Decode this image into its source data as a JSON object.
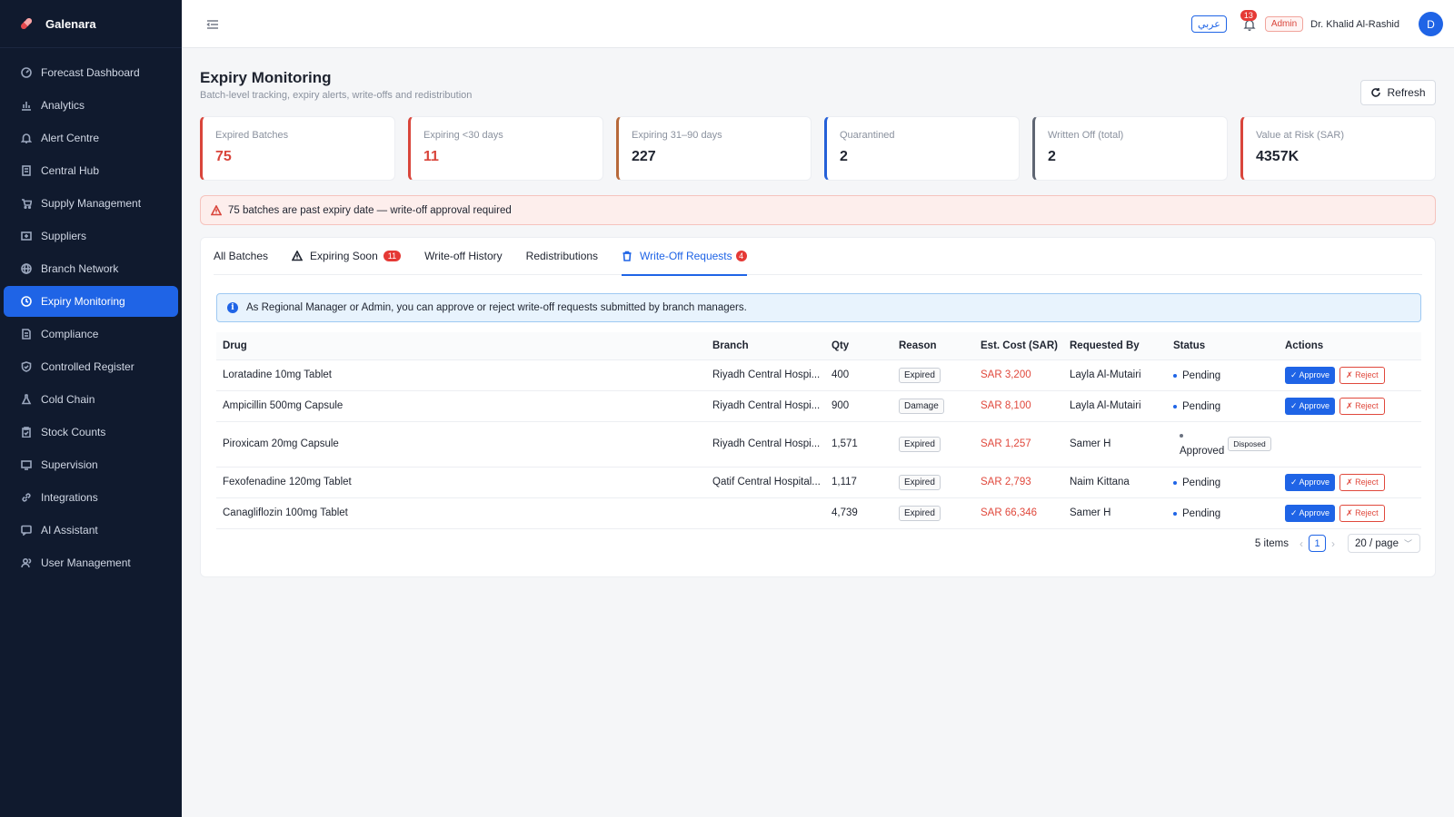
{
  "brand": {
    "name": "Galenara",
    "accent": "#1f64e6"
  },
  "sidebar": {
    "items": [
      {
        "label": "Forecast Dashboard",
        "icon": "dashboard-icon",
        "active": false
      },
      {
        "label": "Analytics",
        "icon": "bar-chart-icon",
        "active": false
      },
      {
        "label": "Alert Centre",
        "icon": "bell-icon",
        "active": false
      },
      {
        "label": "Central Hub",
        "icon": "building-icon",
        "active": false
      },
      {
        "label": "Supply Management",
        "icon": "cart-icon",
        "active": false
      },
      {
        "label": "Suppliers",
        "icon": "supplier-icon",
        "active": false
      },
      {
        "label": "Branch Network",
        "icon": "globe-icon",
        "active": false
      },
      {
        "label": "Expiry Monitoring",
        "icon": "clock-icon",
        "active": true
      },
      {
        "label": "Compliance",
        "icon": "document-icon",
        "active": false
      },
      {
        "label": "Controlled Register",
        "icon": "shield-icon",
        "active": false
      },
      {
        "label": "Cold Chain",
        "icon": "flask-icon",
        "active": false
      },
      {
        "label": "Stock Counts",
        "icon": "clipboard-icon",
        "active": false
      },
      {
        "label": "Supervision",
        "icon": "monitor-icon",
        "active": false
      },
      {
        "label": "Integrations",
        "icon": "link-icon",
        "active": false
      },
      {
        "label": "AI Assistant",
        "icon": "chat-icon",
        "active": false
      },
      {
        "label": "User Management",
        "icon": "users-icon",
        "active": false
      }
    ]
  },
  "topbar": {
    "lang_label": "عربي",
    "notif_count": "13",
    "role": "Admin",
    "user_name": "Dr. Khalid Al-Rashid",
    "avatar_initial": "D"
  },
  "page": {
    "title": "Expiry Monitoring",
    "subtitle": "Batch-level tracking, expiry alerts, write-offs and redistribution",
    "refresh_label": "Refresh"
  },
  "kpis": [
    {
      "label": "Expired Batches",
      "value": "75",
      "variant": "red"
    },
    {
      "label": "Expiring <30 days",
      "value": "11",
      "variant": "red"
    },
    {
      "label": "Expiring 31–90 days",
      "value": "227",
      "variant": "orange"
    },
    {
      "label": "Quarantined",
      "value": "2",
      "variant": "blue"
    },
    {
      "label": "Written Off (total)",
      "value": "2",
      "variant": "gray"
    },
    {
      "label": "Value at Risk (SAR)",
      "value": "4357K",
      "variant": "red-plain"
    }
  ],
  "alert": {
    "text": "75 batches are past expiry date — write-off approval required"
  },
  "tabs": [
    {
      "label": "All Batches"
    },
    {
      "label": "Expiring Soon",
      "badge": "11"
    },
    {
      "label": "Write-off History"
    },
    {
      "label": "Redistributions"
    },
    {
      "label": "Write-Off Requests",
      "badge": "4"
    }
  ],
  "info": {
    "text": "As Regional Manager or Admin, you can approve or reject write-off requests submitted by branch managers."
  },
  "table": {
    "headers": [
      "Drug",
      "Branch",
      "Qty",
      "Reason",
      "Est. Cost (SAR)",
      "Requested By",
      "Status",
      "Actions"
    ],
    "rows": [
      {
        "drug": "Loratadine 10mg Tablet",
        "branch": "Riyadh Central Hospi...",
        "qty": "400",
        "reason": "Expired",
        "cost": "SAR 3,200",
        "requested_by": "Layla Al-Mutairi",
        "status": "Pending"
      },
      {
        "drug": "Ampicillin 500mg Capsule",
        "branch": "Riyadh Central Hospi...",
        "qty": "900",
        "reason": "Damage",
        "cost": "SAR 8,100",
        "requested_by": "Layla Al-Mutairi",
        "status": "Pending"
      },
      {
        "drug": "Piroxicam 20mg Capsule",
        "branch": "Riyadh Central Hospi...",
        "qty": "1,571",
        "reason": "Expired",
        "cost": "SAR 1,257",
        "requested_by": "Samer H",
        "status": "Approved",
        "extra_tag": "Disposed"
      },
      {
        "drug": "Fexofenadine 120mg Tablet",
        "branch": "Qatif Central Hospital...",
        "qty": "1,117",
        "reason": "Expired",
        "cost": "SAR 2,793",
        "requested_by": "Naim Kittana",
        "status": "Pending"
      },
      {
        "drug": "Canagliflozin 100mg Tablet",
        "branch": "",
        "qty": "4,739",
        "reason": "Expired",
        "cost": "SAR 66,346",
        "requested_by": "Samer H",
        "status": "Pending"
      }
    ],
    "approve_label": "✓ Approve",
    "reject_label": "✗ Reject"
  },
  "pagination": {
    "total": "5 items",
    "current": "1",
    "page_size": "20 / page"
  }
}
